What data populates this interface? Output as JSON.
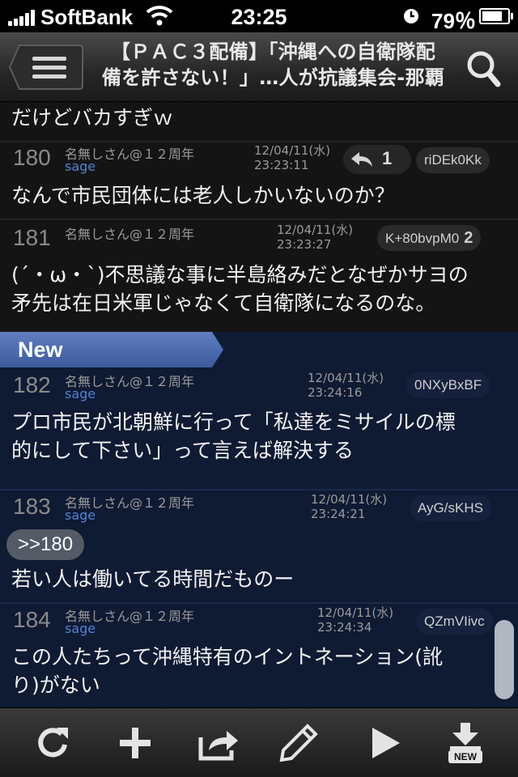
{
  "status_bar": {
    "carrier": "SoftBank",
    "time": "23:25",
    "battery_percent": "79％",
    "battery_level": 0.79
  },
  "nav": {
    "title_line1": "【ＰＡＣ３配備】「沖縄への自衛隊配",
    "title_line2": "備を許さない！」…人が抗議集会-那覇"
  },
  "partial_post_text": "だけどバカすぎｗ",
  "new_label": "New",
  "posts": [
    {
      "num": "180",
      "name": "名無しさん@１２周年",
      "mail": "sage",
      "date": "12/04/11(水)",
      "time": "23:23:11",
      "id": "riDEk0Kk",
      "reply_count": "1",
      "body": "なんで市民団体には老人しかいないのか？"
    },
    {
      "num": "181",
      "name": "名無しさん@１２周年",
      "mail": "",
      "date": "12/04/11(水)",
      "time": "23:23:27",
      "id": "K+80bvpM0",
      "id_count": "2",
      "body_line1": "(´・ω・`)不思議な事に半島絡みだとなぜかサヨの",
      "body_line2": "矛先は在日米軍じゃなくて自衛隊になるのな。"
    },
    {
      "num": "182",
      "name": "名無しさん@１２周年",
      "mail": "sage",
      "date": "12/04/11(水)",
      "time": "23:24:16",
      "id": "0NXyBxBF",
      "body_line1": "プロ市民が北朝鮮に行って「私達をミサイルの標",
      "body_line2": "的にして下さい」って言えば解決する"
    },
    {
      "num": "183",
      "name": "名無しさん@１２周年",
      "mail": "sage",
      "date": "12/04/11(水)",
      "time": "23:24:21",
      "id": "AyG/sKHS",
      "anchor": ">>180",
      "body": "若い人は働いてる時間だものー"
    },
    {
      "num": "184",
      "name": "名無しさん@１２周年",
      "mail": "sage",
      "date": "12/04/11(水)",
      "time": "23:24:34",
      "id": "QZmVIivc",
      "body_line1": "この人たちって沖縄特有のイントネーション(訛",
      "body_line2": "り)がない"
    }
  ],
  "toolbar": {
    "reload_icon": "reload-icon",
    "add_icon": "plus-icon",
    "share_icon": "share-icon",
    "write_icon": "pencil-icon",
    "play_icon": "play-icon",
    "download_new_label": "NEW"
  }
}
